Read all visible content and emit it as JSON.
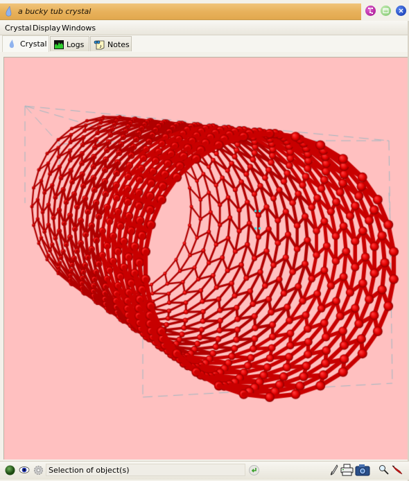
{
  "window": {
    "title": "a bucky tub crystal",
    "title_icon": "crystal-drop-icon",
    "controls": [
      {
        "name": "graph-button",
        "icon": "graph-nodes-icon",
        "color": "#b0169a"
      },
      {
        "name": "maximize-button",
        "icon": "window-icon",
        "color": "#8fd07a"
      },
      {
        "name": "close-button",
        "icon": "close-icon",
        "color": "#1646c8"
      }
    ]
  },
  "menubar": {
    "items": [
      "Crystal",
      "Display",
      "Windows"
    ]
  },
  "tabs": [
    {
      "label": "Crystal",
      "icon": "crystal-drop-icon",
      "active": true
    },
    {
      "label": "Logs",
      "icon": "log-chart-icon",
      "active": false
    },
    {
      "label": "Notes",
      "icon": "notes-icon",
      "active": false
    }
  ],
  "viewport": {
    "description": "3D view of a carbon nanotube (bucky tube) rendered as red ball-and-stick atoms inside a dashed bounding box",
    "background_color": "#ffc0c0",
    "atom_color": "#e00000",
    "box_color": "#9fb8c0",
    "selection_marker_color": "#33e0e8"
  },
  "statusbar": {
    "left_icons": [
      "status-light-icon",
      "eye-icon",
      "gear-icon"
    ],
    "message": "Selection of object(s)",
    "enter_icon": "enter-icon",
    "right_icons": [
      "pen-icon",
      "print-icon",
      "camera-icon",
      "magnifier-icon",
      "marker-icon"
    ]
  }
}
